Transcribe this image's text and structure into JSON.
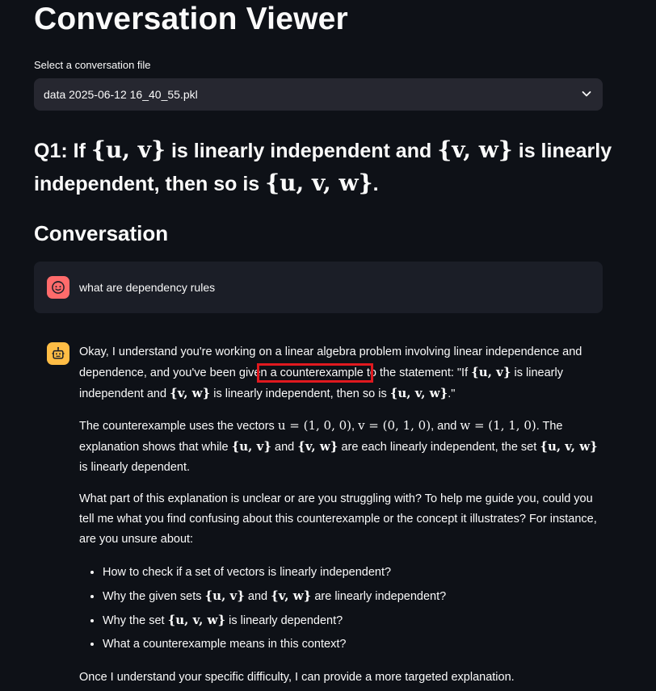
{
  "header": {
    "title": "Conversation Viewer"
  },
  "file_select": {
    "label": "Select a conversation file",
    "value": "data 2025-06-12 16_40_55.pkl"
  },
  "question": {
    "prefix": "Q1: If",
    "set1": "{u, v}",
    "mid1": "is linearly independent and",
    "set2": "{v, w}",
    "mid2": "is linearly independent, then so is",
    "set3": "{u, v, w}",
    "end": "."
  },
  "section_title": "Conversation",
  "user_message": {
    "text": "what are dependency rules"
  },
  "assistant": {
    "p1_a": "Okay, I understand you're working on a linear algebra problem involving linear independence and dependence, and you've been give",
    "p1_highlight": "n a counterexample t",
    "p1_b": "o the statement: \"If",
    "p1_set1": "{u, v}",
    "p1_c": "is linearly independent and",
    "p1_set2": "{v, w}",
    "p1_d": "is linearly independent, then so is",
    "p1_set3": "{u, v, w}",
    "p1_e": ".\"",
    "p2_a": "The counterexample uses the vectors",
    "p2_u": "u = (1, 0, 0)",
    "p2_v": "v = (0, 1, 0)",
    "p2_and": "and",
    "p2_w": "w = (1, 1, 0)",
    "p2_b": ". The explanation shows that while",
    "p2_set1": "{u, v}",
    "p2_c": "and",
    "p2_set2": "{v, w}",
    "p2_d": "are each linearly independent, the set",
    "p2_set3": "{u, v, w}",
    "p2_e": "is linearly dependent.",
    "p3": "What part of this explanation is unclear or are you struggling with? To help me guide you, could you tell me what you find confusing about this counterexample or the concept it illustrates? For instance, are you unsure about:",
    "bullets": {
      "b1": "How to check if a set of vectors is linearly independent?",
      "b2_a": "Why the given sets",
      "b2_set1": "{u, v}",
      "b2_and": "and",
      "b2_set2": "{v, w}",
      "b2_b": "are linearly independent?",
      "b3_a": "Why the set",
      "b3_set": "{u, v, w}",
      "b3_b": "is linearly dependent?",
      "b4": "What a counterexample means in this context?"
    },
    "p4": "Once I understand your specific difficulty, I can provide a more targeted explanation."
  },
  "colors": {
    "background": "#0e1117",
    "select_bg": "#262730",
    "user_avatar": "#ff6b6b",
    "bot_avatar": "#ffbd45",
    "highlight_box": "#e0191f"
  },
  "icons": {
    "dropdown": "chevron-down-icon",
    "user_avatar": "smiley-face-icon",
    "bot_avatar": "robot-icon"
  }
}
